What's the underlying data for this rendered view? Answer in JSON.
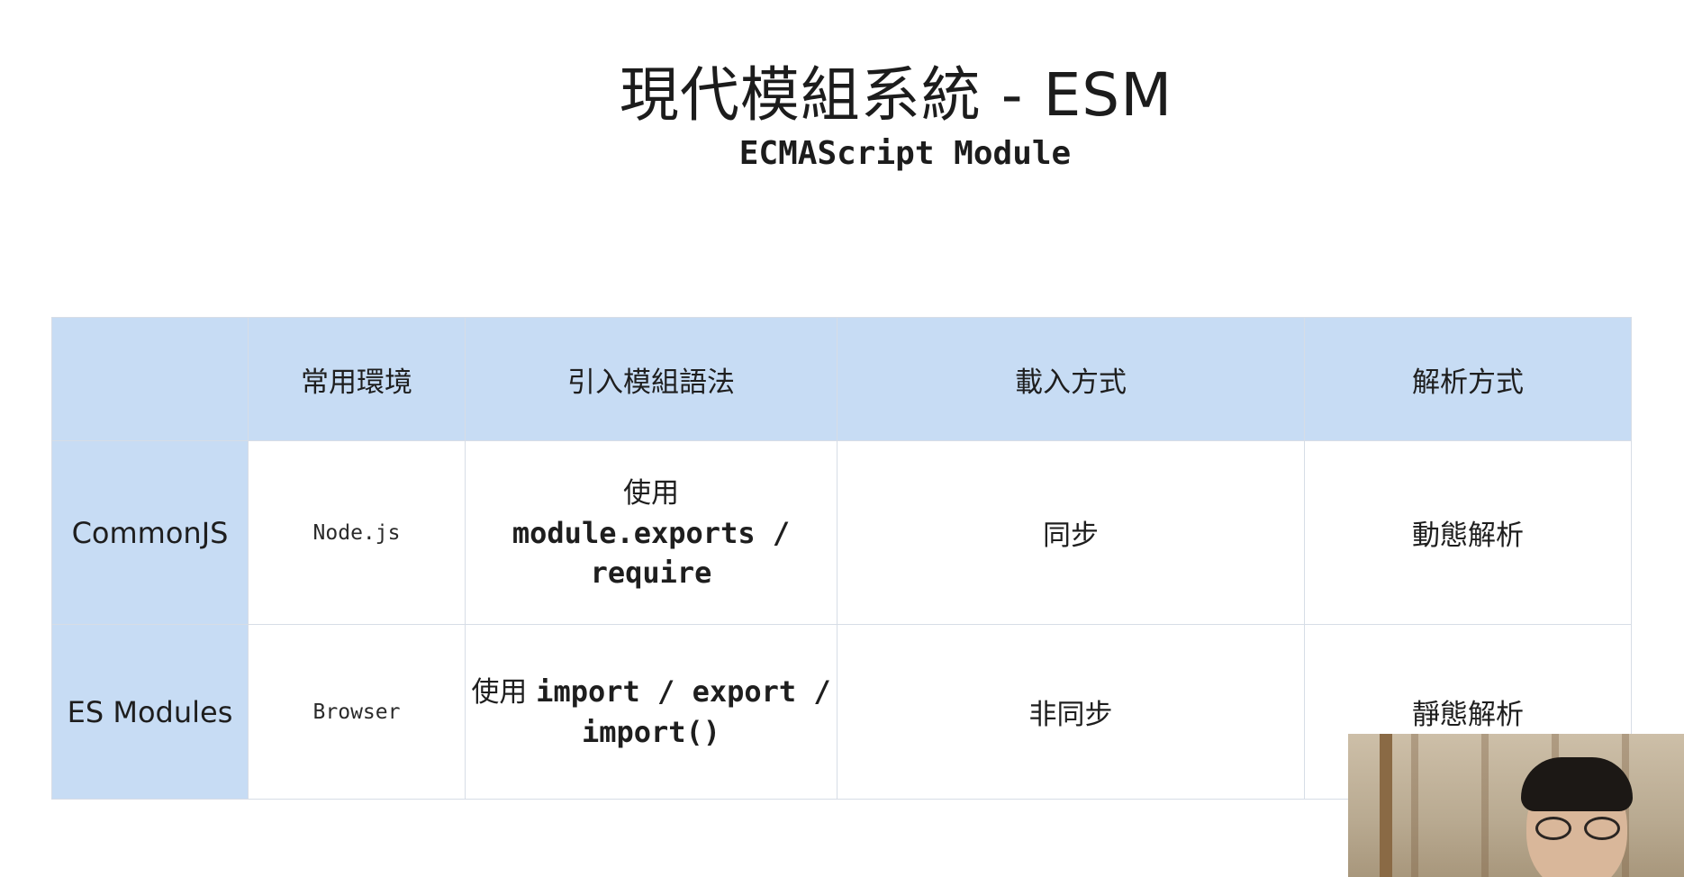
{
  "slide": {
    "title": "現代模組系統 - ESM",
    "subtitle": "ECMAScript Module"
  },
  "table": {
    "headers": [
      "",
      "常用環境",
      "引入模組語法",
      "載入方式",
      "解析方式"
    ],
    "rows": [
      {
        "name": "CommonJS",
        "environment": "Node.js",
        "syntax_prefix": "使用",
        "syntax_code": "module.exports / require",
        "loading": "同步",
        "parsing": "動態解析"
      },
      {
        "name": "ES Modules",
        "environment": "Browser",
        "syntax_prefix": "使用",
        "syntax_code": "import / export / import()",
        "loading": "非同步",
        "parsing": "靜態解析"
      }
    ]
  },
  "colors": {
    "header_background": "#c7dcf4",
    "border": "#d7dde6",
    "text": "#1e1e1e"
  }
}
